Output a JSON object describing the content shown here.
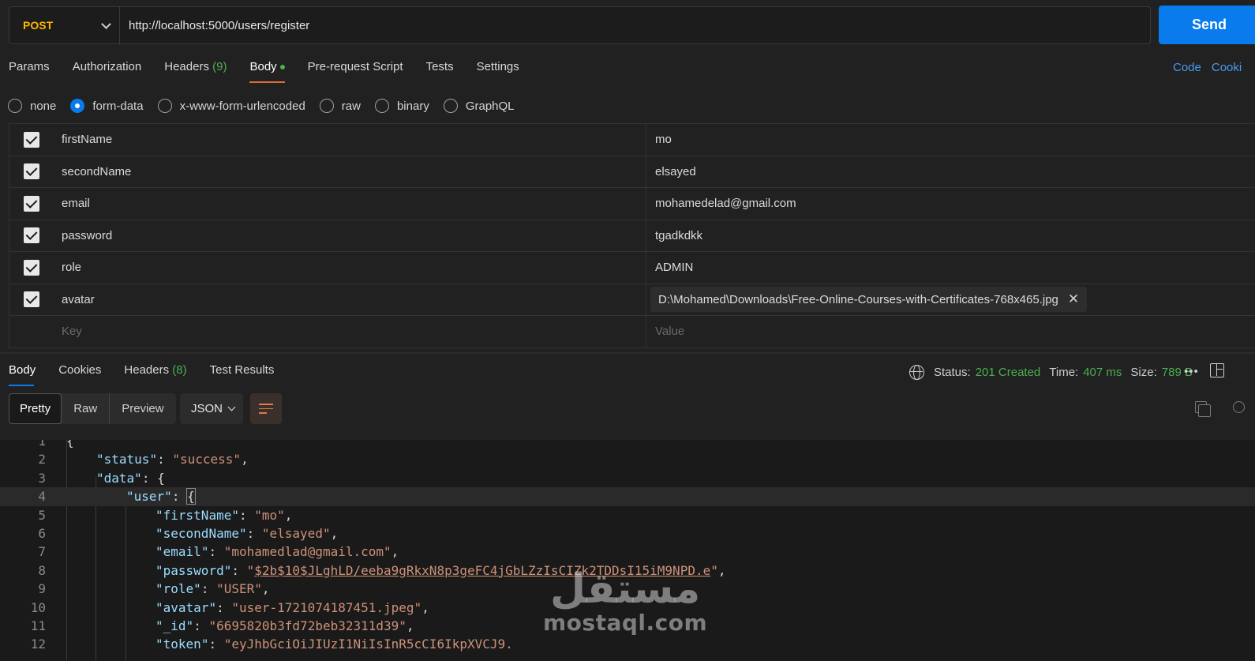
{
  "request": {
    "method": "POST",
    "url": "http://localhost:5000/users/register",
    "send_label": "Send"
  },
  "request_tabs": [
    {
      "label": "Params"
    },
    {
      "label": "Authorization"
    },
    {
      "label": "Headers",
      "count": "(9)"
    },
    {
      "label": "Body",
      "active": true
    },
    {
      "label": "Pre-request Script"
    },
    {
      "label": "Tests"
    },
    {
      "label": "Settings"
    }
  ],
  "right_links": {
    "code": "Code",
    "cookies": "Cooki"
  },
  "body_types": [
    {
      "label": "none"
    },
    {
      "label": "form-data",
      "selected": true
    },
    {
      "label": "x-www-form-urlencoded"
    },
    {
      "label": "raw"
    },
    {
      "label": "binary"
    },
    {
      "label": "GraphQL"
    }
  ],
  "form_rows": [
    {
      "key": "firstName",
      "value": "mo"
    },
    {
      "key": "secondName",
      "value": "elsayed"
    },
    {
      "key": "email",
      "value": "mohamedelad@gmail.com"
    },
    {
      "key": "password",
      "value": "tgadkdkk"
    },
    {
      "key": "role",
      "value": "ADMIN"
    },
    {
      "key": "avatar",
      "value": "D:\\Mohamed\\Downloads\\Free-Online-Courses-with-Certificates-768x465.jpg",
      "is_file": true
    }
  ],
  "form_placeholder": {
    "key": "Key",
    "value": "Value"
  },
  "response_tabs": [
    {
      "label": "Body",
      "active": true
    },
    {
      "label": "Cookies"
    },
    {
      "label": "Headers",
      "count": "(8)"
    },
    {
      "label": "Test Results"
    }
  ],
  "status": {
    "status_label": "Status:",
    "status_value": "201 Created",
    "time_label": "Time:",
    "time_value": "407 ms",
    "size_label": "Size:",
    "size_value": "789 B",
    "more": "•••"
  },
  "view_modes": [
    "Pretty",
    "Raw",
    "Preview"
  ],
  "format": "JSON",
  "code_lines": [
    {
      "n": "1",
      "text": "{"
    },
    {
      "n": "2",
      "key": "status",
      "value": "success",
      "indent": 1
    },
    {
      "n": "3",
      "key": "data",
      "open": "{",
      "indent": 1
    },
    {
      "n": "4",
      "key": "user",
      "open": "{",
      "indent": 2,
      "highlight": true
    },
    {
      "n": "5",
      "key": "firstName",
      "value": "mo",
      "indent": 3
    },
    {
      "n": "6",
      "key": "secondName",
      "value": "elsayed",
      "indent": 3
    },
    {
      "n": "7",
      "key": "email",
      "value": "mohamedlad@gmail.com",
      "indent": 3
    },
    {
      "n": "8",
      "key": "password",
      "value": "$2b$10$JLghLD/eeba9gRkxN8p3geFC4jGbLZzIsCIZk2TDDsI15iM9NPD.e",
      "indent": 3
    },
    {
      "n": "9",
      "key": "role",
      "value": "USER",
      "indent": 3
    },
    {
      "n": "10",
      "key": "avatar",
      "value": "user-1721074187451.jpeg",
      "indent": 3
    },
    {
      "n": "11",
      "key": "_id",
      "value": "6695820b3fd72beb32311d39",
      "indent": 3
    },
    {
      "n": "12",
      "key": "token",
      "value": "eyJhbGciOiJIUzI1NiIsInR5cCI6IkpXVCJ9.",
      "indent": 3
    }
  ],
  "watermark": {
    "arabic": "مستقل",
    "latin": "mostaql.com"
  },
  "colors": {
    "accent": "#097bed",
    "method": "#ffb400",
    "success": "#4caf50",
    "json_key": "#9cdcfe",
    "json_string": "#ce9178"
  }
}
